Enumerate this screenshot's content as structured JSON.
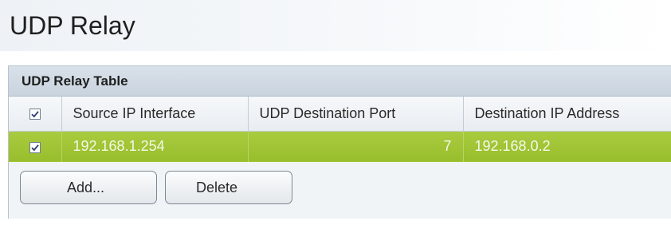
{
  "page": {
    "title": "UDP Relay"
  },
  "panel": {
    "title": "UDP Relay Table"
  },
  "table": {
    "columns": [
      "Source IP Interface",
      "UDP Destination Port",
      "Destination IP Address"
    ],
    "header_checked": true,
    "rows": [
      {
        "checked": true,
        "source_ip_interface": "192.168.1.254",
        "udp_destination_port": "7",
        "destination_ip_address": "192.168.0.2"
      }
    ]
  },
  "buttons": {
    "add_label": "Add...",
    "delete_label": "Delete"
  },
  "colors": {
    "selected_row": "#a2c637",
    "header_bar": "#d3dbe4"
  }
}
